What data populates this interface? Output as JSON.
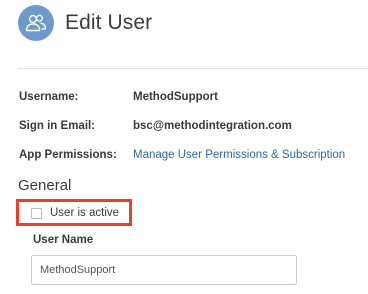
{
  "header": {
    "title": "Edit User",
    "icon": "users-icon",
    "icon_bg_color": "#6d9acb"
  },
  "info": {
    "username_label": "Username:",
    "username_value": "MethodSupport",
    "email_label": "Sign in Email:",
    "email_value": "bsc@methodintegration.com",
    "permissions_label": "App Permissions:",
    "permissions_link": "Manage User Permissions & Subscription"
  },
  "general": {
    "section_title": "General",
    "active_checkbox_label": "User is active",
    "active_checked": false,
    "user_name_label": "User Name",
    "user_name_value": "MethodSupport"
  },
  "colors": {
    "link": "#2b6aa3",
    "highlight": "#e8422c"
  }
}
